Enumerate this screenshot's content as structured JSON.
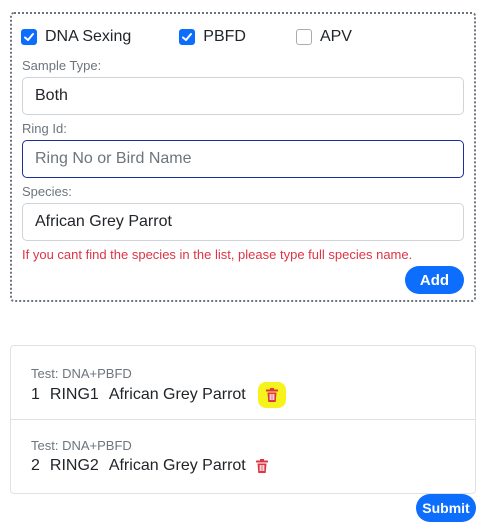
{
  "tests": [
    {
      "label": "DNA Sexing",
      "checked": true
    },
    {
      "label": "PBFD",
      "checked": true
    },
    {
      "label": "APV",
      "checked": false
    }
  ],
  "sample_type": {
    "label": "Sample Type:",
    "value": "Both"
  },
  "ring_id": {
    "label": "Ring Id:",
    "placeholder": "Ring No or Bird Name"
  },
  "species": {
    "label": "Species:",
    "value": "African Grey Parrot"
  },
  "hint": "If you cant find the species in the list, please type full species name.",
  "add_label": "Add",
  "submit_label": "Submit",
  "items": [
    {
      "test": "Test: DNA+PBFD",
      "index": "1",
      "ring": "RING1",
      "species": "African Grey Parrot"
    },
    {
      "test": "Test: DNA+PBFD",
      "index": "2",
      "ring": "RING2",
      "species": "African Grey Parrot"
    }
  ],
  "colors": {
    "accent": "#0d6efd",
    "danger": "#dc3545",
    "highlight": "#f6f31c"
  },
  "icons": {
    "checkbox_checked": "check-icon",
    "delete": "trash-icon"
  }
}
